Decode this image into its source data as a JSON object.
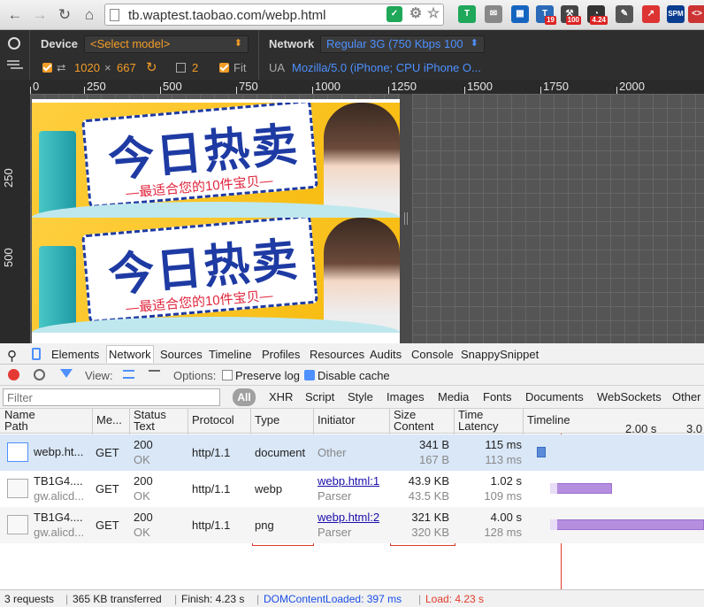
{
  "browser": {
    "url": "tb.waptest.taobao.com/webp.html",
    "extensions": [
      {
        "icon": "tamper-icon",
        "label": "T",
        "color": "#1fa75a"
      },
      {
        "icon": "mail-icon",
        "label": "✉",
        "color": "#888"
      },
      {
        "icon": "qr-icon",
        "label": "▦",
        "color": "#1565c0"
      },
      {
        "icon": "text-icon",
        "label": "T",
        "color": "#2a6ab8",
        "badge": "19"
      },
      {
        "icon": "tool-icon",
        "label": "⚒",
        "color": "#444",
        "badge": "100"
      },
      {
        "icon": "clock-icon",
        "label": "◔",
        "color": "#333",
        "badge": "4.24"
      },
      {
        "icon": "wrench-icon",
        "label": "✎",
        "color": "#555"
      },
      {
        "icon": "chart-icon",
        "label": "↗",
        "color": "#d33"
      },
      {
        "icon": "spm-icon",
        "label": "SPM",
        "color": "#0a3d8f"
      },
      {
        "icon": "code-icon",
        "label": "<>",
        "color": "#c33"
      }
    ]
  },
  "emulation": {
    "device_label": "Device",
    "device_select": "<Select model>",
    "network_label": "Network",
    "network_select": "Regular 3G (750 Kbps 100",
    "width": "1020",
    "x": "×",
    "height": "667",
    "scale": "2",
    "fit_label": "Fit",
    "ua_label": "UA",
    "ua_value": "Mozilla/5.0 (iPhone; CPU iPhone O..."
  },
  "ruler": {
    "h_ticks": [
      "0",
      "250",
      "500",
      "750",
      "1000",
      "1250",
      "1500",
      "1750",
      "2000"
    ],
    "v_ticks": [
      "250",
      "500"
    ]
  },
  "banner": {
    "big_text": "今日热卖",
    "sub_text": "—最适合您的10件宝贝—"
  },
  "devtools": {
    "tabs": [
      "Elements",
      "Network",
      "Sources",
      "Timeline",
      "Profiles",
      "Resources",
      "Audits",
      "Console",
      "SnappySnippet"
    ],
    "view_label": "View:",
    "options_label": "Options:",
    "preserve_log": "Preserve log",
    "disable_cache": "Disable cache",
    "filter_placeholder": "Filter",
    "all_label": "All",
    "types": [
      "XHR",
      "Script",
      "Style",
      "Images",
      "Media",
      "Fonts",
      "Documents",
      "WebSockets",
      "Other"
    ]
  },
  "table": {
    "headers": {
      "name": "Name",
      "path": "Path",
      "method": "Me...",
      "status": "Status",
      "status_text": "Text",
      "protocol": "Protocol",
      "type": "Type",
      "initiator": "Initiator",
      "size": "Size",
      "content": "Content",
      "time": "Time",
      "latency": "Latency",
      "timeline": "Timeline",
      "tl_2": "2.00 s",
      "tl_3": "3.0"
    },
    "rows": [
      {
        "name": "webp.ht...",
        "path": "",
        "method": "GET",
        "status": "200",
        "status_text": "OK",
        "protocol": "http/1.1",
        "type": "document",
        "initiator": "Other",
        "initiator_sub": "",
        "size": "341 B",
        "content": "167 B",
        "time": "115 ms",
        "latency": "113 ms"
      },
      {
        "name": "TB1G4....",
        "path": "gw.alicd...",
        "method": "GET",
        "status": "200",
        "status_text": "OK",
        "protocol": "http/1.1",
        "type": "webp",
        "initiator": "webp.html:1",
        "initiator_sub": "Parser",
        "size": "43.9 KB",
        "content": "43.5 KB",
        "time": "1.02 s",
        "latency": "109 ms"
      },
      {
        "name": "TB1G4....",
        "path": "gw.alicd...",
        "method": "GET",
        "status": "200",
        "status_text": "OK",
        "protocol": "http/1.1",
        "type": "png",
        "initiator": "webp.html:2",
        "initiator_sub": "Parser",
        "size": "321 KB",
        "content": "320 KB",
        "time": "4.00 s",
        "latency": "128 ms"
      }
    ]
  },
  "status_bar": {
    "requests": "3 requests",
    "transferred": "365 KB transferred",
    "finish": "Finish: 4.23 s",
    "dcl": "DOMContentLoaded: 397 ms",
    "load": "Load: 4.23 s"
  }
}
